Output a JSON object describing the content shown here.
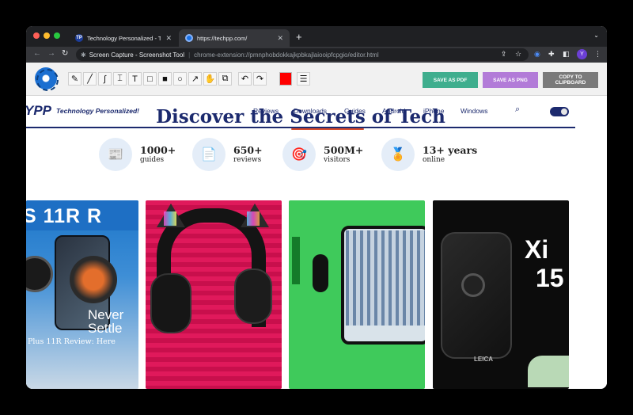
{
  "browser": {
    "tabs": [
      {
        "title": "Technology Personalized - Tech",
        "favicon_text": "TP",
        "active": false
      },
      {
        "title": "https://techpp.com/",
        "favicon_text": "",
        "active": true
      }
    ],
    "new_tab_symbol": "+",
    "tab_menu_symbol": "⌄",
    "omnibox": {
      "extension_name": "Screen Capture - Screenshot Tool",
      "url": "chrome-extension://pmnphobdokkajkpbkajlaiooipfcpgio/editor.html"
    },
    "profile_initial": "Y"
  },
  "editor": {
    "tools": [
      {
        "name": "pencil-tool",
        "glyph": "✎"
      },
      {
        "name": "line-tool",
        "glyph": "╱"
      },
      {
        "name": "curve-tool",
        "glyph": "∫"
      },
      {
        "name": "text-cursor-tool",
        "glyph": "⌶"
      },
      {
        "name": "text-tool",
        "glyph": "T"
      },
      {
        "name": "rectangle-tool",
        "glyph": "□"
      },
      {
        "name": "filled-rectangle-tool",
        "glyph": "■"
      },
      {
        "name": "ellipse-tool",
        "glyph": "○"
      },
      {
        "name": "arrow-tool",
        "glyph": "↗"
      },
      {
        "name": "hand-tool",
        "glyph": "✋"
      },
      {
        "name": "crop-tool",
        "glyph": "⧉"
      }
    ],
    "undo_glyph": "↶",
    "redo_glyph": "↷",
    "menu_glyph": "☰",
    "selected_color": "#ff0000",
    "save_pdf_label": "SAVE AS PDF",
    "save_png_label": "SAVE AS PNG",
    "copy_clipboard_label_1": "COPY TO",
    "copy_clipboard_label_2": "CLIPBOARD",
    "colors": {
      "pdf": "#3fae8e",
      "png": "#b27bd8",
      "copy": "#7a7a7a"
    }
  },
  "site": {
    "logo_text": "YPP",
    "tagline": "Technology Personalized!",
    "nav": [
      "Reviews",
      "Downloads",
      "Guides",
      "Android",
      "iPhone",
      "Windows"
    ],
    "hero_prefix": "Discover the ",
    "hero_accent": "Secrets",
    "hero_suffix": " of Tech",
    "stats": [
      {
        "number": "1000+",
        "label": "guides",
        "icon": "📰"
      },
      {
        "number": "650+",
        "label": "reviews",
        "icon": "📄"
      },
      {
        "number": "500M+",
        "label": "visitors",
        "icon": "🎯"
      },
      {
        "number": "13+ years",
        "label": "online",
        "icon": "🏅"
      }
    ],
    "cards": [
      {
        "headline": "S 11R R",
        "overlay_1": "Never",
        "overlay_2": "Settle",
        "caption": "Plus 11R Review: Here"
      },
      {
        "headline": ""
      },
      {
        "headline": ""
      },
      {
        "headline_1": "Xi",
        "headline_2": "15",
        "badge": "LEICA"
      }
    ]
  }
}
